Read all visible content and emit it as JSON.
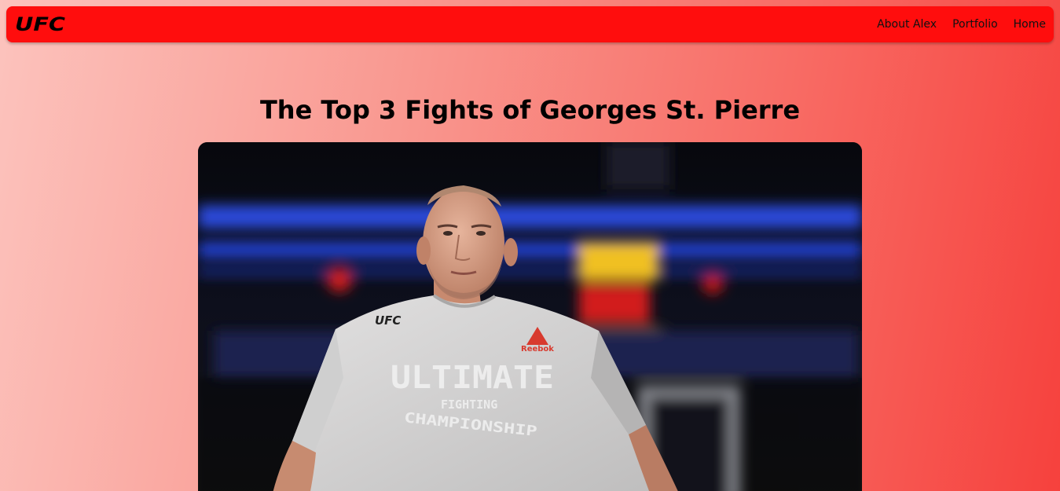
{
  "nav": {
    "logo_text": "UFC",
    "links": [
      {
        "label": "About Alex"
      },
      {
        "label": "Portfolio"
      },
      {
        "label": "Home"
      }
    ]
  },
  "main": {
    "title": "The Top 3 Fights of Georges St. Pierre"
  },
  "hero_photo": {
    "shirt_brand": "Reebok",
    "shirt_logo": "UFC",
    "shirt_line1": "ULTIMATE",
    "shirt_line2": "FIGHTING",
    "shirt_line3": "CHAMPIONSHIP"
  },
  "colors": {
    "navbar": "#ff0d0d",
    "background_start": "#fcc3bd",
    "background_end": "#f6413d"
  }
}
